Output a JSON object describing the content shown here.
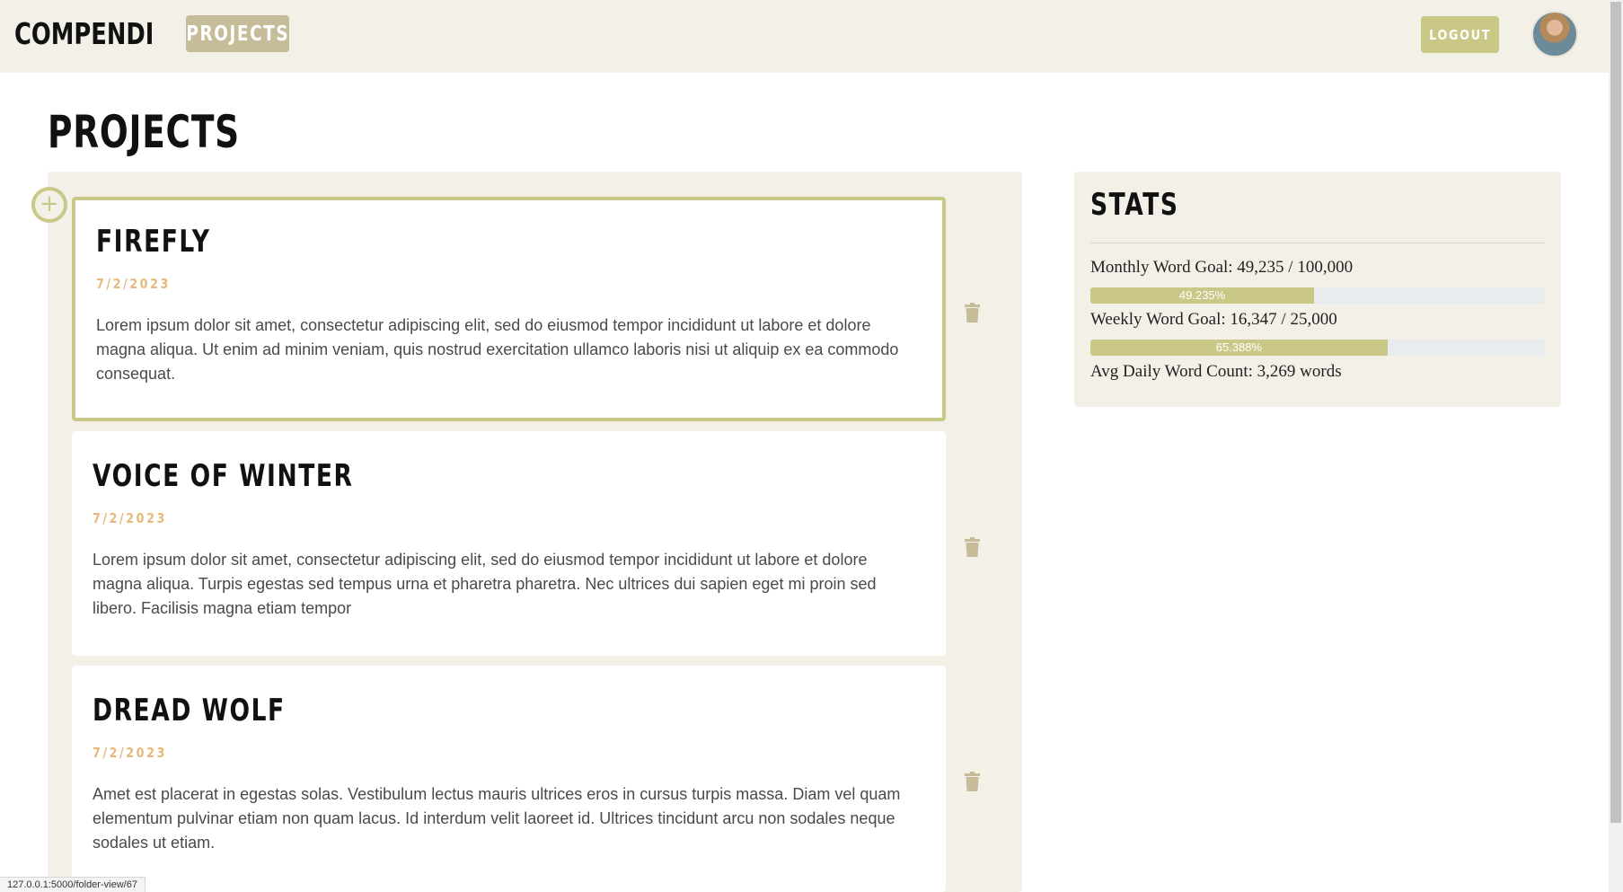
{
  "header": {
    "brand": "COMPENDI",
    "nav_projects": "PROJECTS",
    "logout": "LOGOUT"
  },
  "page": {
    "title": "PROJECTS"
  },
  "add_button": {
    "glyph": "+"
  },
  "projects": [
    {
      "title": "FIREFLY",
      "date": "7/2/2023",
      "body": "Lorem ipsum dolor sit amet, consectetur adipiscing elit, sed do eiusmod tempor incididunt ut labore et dolore magna aliqua. Ut enim ad minim veniam, quis nostrud exercitation ullamco laboris nisi ut aliquip ex ea commodo consequat."
    },
    {
      "title": "VOICE OF WINTER",
      "date": "7/2/2023",
      "body": "Lorem ipsum dolor sit amet, consectetur adipiscing elit, sed do eiusmod tempor incididunt ut labore et dolore magna aliqua. Turpis egestas sed tempus urna et pharetra pharetra. Nec ultrices dui sapien eget mi proin sed libero. Facilisis magna etiam tempor"
    },
    {
      "title": "DREAD WOLF",
      "date": "7/2/2023",
      "body": "Amet est placerat in egestas solas. Vestibulum lectus mauris ultrices eros in cursus turpis massa. Diam vel quam elementum pulvinar etiam non quam lacus. Id interdum velit laoreet id. Ultrices tincidunt arcu non sodales neque sodales ut etiam."
    }
  ],
  "stats": {
    "title": "STATS",
    "monthly": "Monthly Word Goal: 49,235 / 100,000",
    "monthly_progress": "49.235%",
    "monthly_fraction": 0.49235,
    "weekly": "Weekly Word Goal: 16,347 / 25,000",
    "weekly_progress": "65.388%",
    "weekly_fraction": 0.65388,
    "daily": "Avg Daily Word Count: 3,269 words"
  },
  "status_bar": {
    "url": "127.0.0.1:5000/folder-view/67"
  },
  "colors": {
    "accent": "#c9c887",
    "nav_active": "#c6bc9a",
    "panel_bg": "#f3f0e8",
    "date": "#e6b97a",
    "trash": "#c6bc9a"
  },
  "icons": {
    "add": "plus-circle-icon",
    "delete": "trash-icon",
    "avatar": "user-avatar"
  }
}
